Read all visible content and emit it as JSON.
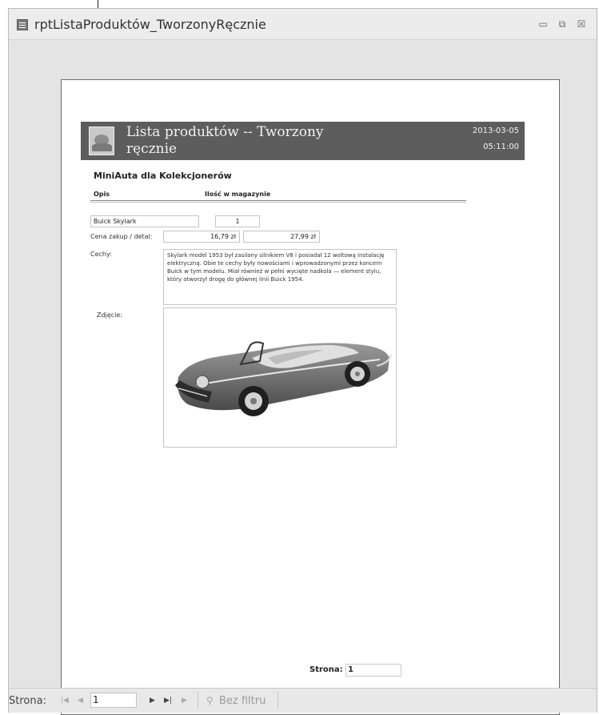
{
  "window": {
    "title": "rptListaProduktów_TworzonyRęcznie",
    "icon": "report-icon",
    "controls": {
      "minimize": "▭",
      "maximize": "⧉",
      "close": "☒"
    }
  },
  "report": {
    "header": {
      "title": "Lista produktów -- Tworzony ręcznie",
      "date": "2013-03-05",
      "time": "05:11:00",
      "background": "#5d5d5d"
    },
    "company": "MiniAuta dla Kolekcjonerów",
    "columns": {
      "desc": "Opis",
      "stock": "Ilość w magazynie"
    },
    "product": {
      "name": "Buick Skylark",
      "stock": "1",
      "price_label": "Cena zakup / detal:",
      "purchase_price": "16,79 zł",
      "retail_price": "27,99 zł",
      "features_label": "Cechy:",
      "features": "Skylark model 1953 był zasilany silnikiem V8 i posiadał 12 woltową instalację elektryczną. Obie te cechy były nowościami i wprowadzonymi przez koncern Buick w tym modelu. Miał również w pełni wycięte nadkola — element stylu, który otworzył drogę do głównej linii Buick 1954.",
      "photo_label": "Zdjęcie:"
    },
    "footer": {
      "page_label": "Strona:",
      "page_number": "1"
    }
  },
  "navbar": {
    "label": "Strona:",
    "current_page": "1",
    "filter_label": "Bez filtru"
  }
}
